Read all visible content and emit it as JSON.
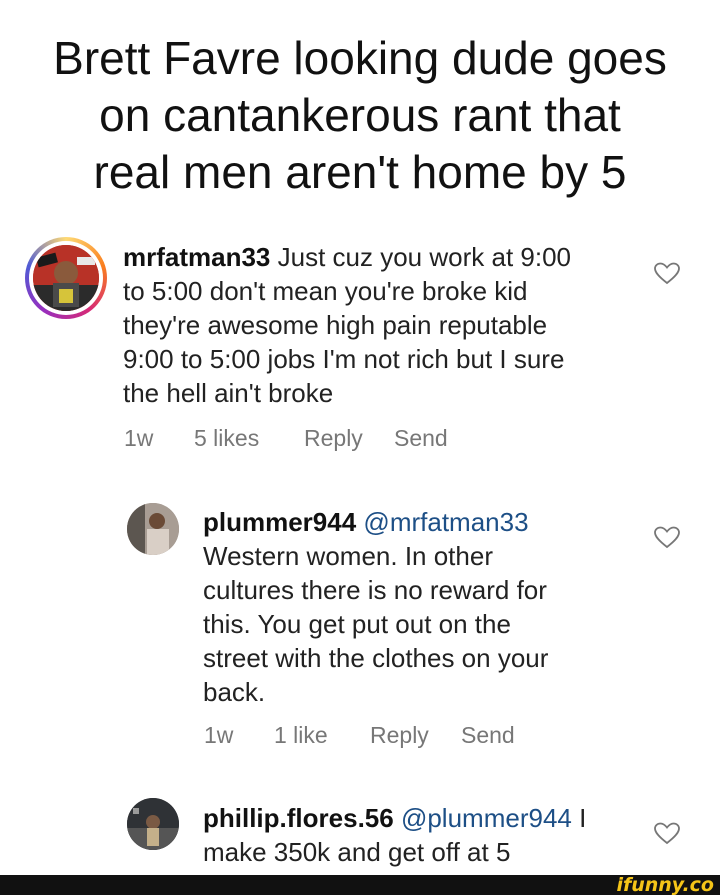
{
  "post": {
    "title_lines": [
      "Brett Favre looking dude goes",
      "on cantankerous rant that",
      "real men aren't home by 5"
    ]
  },
  "comments": [
    {
      "username": "mrfatman33",
      "lines": [
        " Just cuz you work at 9:00",
        "to 5:00 don't mean you're broke kid",
        "they're awesome high pain reputable",
        "9:00 to 5:00 jobs I'm not rich but I sure",
        "the hell ain't broke"
      ],
      "time": "1w",
      "likes": "5 likes",
      "reply": "Reply",
      "send": "Send"
    },
    {
      "username": "plummer944",
      "mention": "@mrfatman33",
      "lines": [
        "Western women.  In other",
        "cultures there is no reward for",
        "this.  You get put out on the",
        "street with the clothes on your",
        "back."
      ],
      "time": "1w",
      "likes": "1 like",
      "reply": "Reply",
      "send": "Send"
    },
    {
      "username": "phillip.flores.56",
      "mention": "@plummer944",
      "line1_tail": " I",
      "lines": [
        "make 350k and get off at 5"
      ]
    }
  ],
  "watermark": "ifunny.co",
  "colors": {
    "mention": "#1d4f86",
    "meta": "#777777",
    "watermark": "#f5c518"
  }
}
